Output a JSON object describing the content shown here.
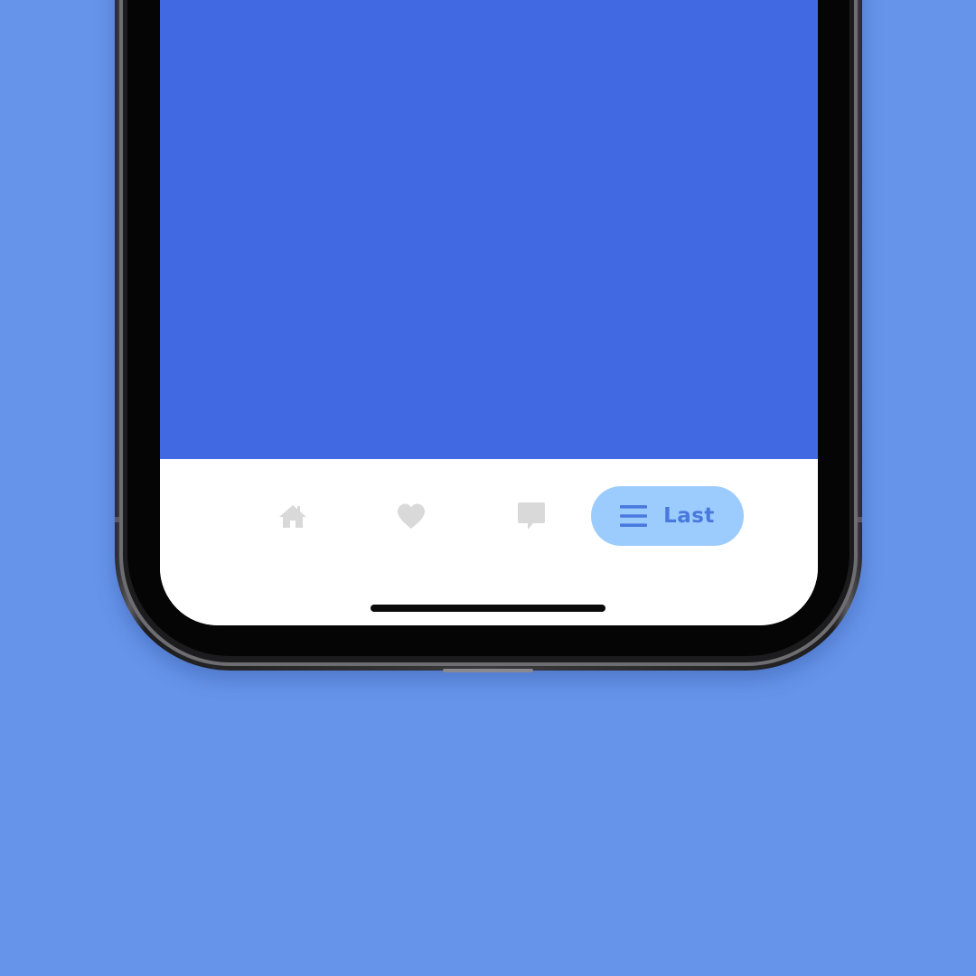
{
  "colors": {
    "page_background": "#6594ea",
    "screen_content": "#4169e1",
    "tab_bar_background": "#ffffff",
    "inactive_icon": "#d9d9d9",
    "active_pill": "#9bccfd",
    "active_accent": "#4a79de"
  },
  "tab_bar": {
    "items": [
      {
        "icon": "home-icon",
        "active": false
      },
      {
        "icon": "heart-icon",
        "active": false
      },
      {
        "icon": "chat-bubble-icon",
        "active": false
      },
      {
        "icon": "menu-icon",
        "label": "Last",
        "active": true
      }
    ]
  }
}
